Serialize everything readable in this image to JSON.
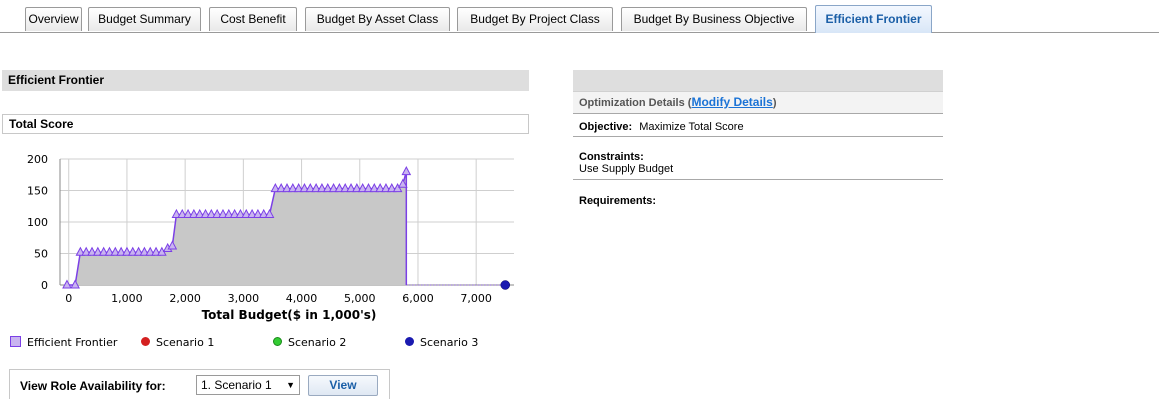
{
  "tabs": [
    {
      "label": "Overview",
      "active": false
    },
    {
      "label": "Budget Summary",
      "active": false
    },
    {
      "label": "Cost Benefit",
      "active": false
    },
    {
      "label": "Budget By Asset Class",
      "active": false
    },
    {
      "label": "Budget By Project Class",
      "active": false
    },
    {
      "label": "Budget By Business Objective",
      "active": false
    },
    {
      "label": "Efficient Frontier",
      "active": true
    }
  ],
  "left_panel": {
    "title": "Efficient Frontier",
    "chart_header": "Total Score"
  },
  "chart_data": {
    "type": "area",
    "title": "Total Score",
    "xlabel": "Total Budget($ in 1,000's)",
    "ylabel": "",
    "xlim": [
      -150,
      7650
    ],
    "ylim": [
      0,
      200
    ],
    "x_ticks": [
      "0",
      "1,000",
      "2,000",
      "3,000",
      "4,000",
      "5,000",
      "6,000",
      "7,000"
    ],
    "y_ticks": [
      "0",
      "50",
      "100",
      "150",
      "200"
    ],
    "grid": true,
    "legend_position": "bottom",
    "series": [
      {
        "name": "Efficient Frontier",
        "color": "#7b3fe6",
        "fill": "#c8c8c8",
        "marker": "triangle",
        "points": [
          [
            -30,
            0
          ],
          [
            110,
            0
          ],
          [
            200,
            52
          ],
          [
            300,
            52
          ],
          [
            400,
            52
          ],
          [
            500,
            52
          ],
          [
            600,
            52
          ],
          [
            700,
            52
          ],
          [
            800,
            52
          ],
          [
            900,
            52
          ],
          [
            1000,
            52
          ],
          [
            1100,
            52
          ],
          [
            1200,
            52
          ],
          [
            1300,
            52
          ],
          [
            1400,
            52
          ],
          [
            1500,
            52
          ],
          [
            1600,
            52
          ],
          [
            1700,
            58
          ],
          [
            1780,
            62
          ],
          [
            1850,
            112
          ],
          [
            1950,
            112
          ],
          [
            2050,
            112
          ],
          [
            2150,
            112
          ],
          [
            2250,
            112
          ],
          [
            2350,
            112
          ],
          [
            2450,
            112
          ],
          [
            2550,
            112
          ],
          [
            2650,
            112
          ],
          [
            2750,
            112
          ],
          [
            2850,
            112
          ],
          [
            2950,
            112
          ],
          [
            3050,
            112
          ],
          [
            3150,
            112
          ],
          [
            3250,
            112
          ],
          [
            3350,
            112
          ],
          [
            3450,
            112
          ],
          [
            3550,
            153
          ],
          [
            3650,
            153
          ],
          [
            3750,
            153
          ],
          [
            3850,
            153
          ],
          [
            3950,
            153
          ],
          [
            4050,
            153
          ],
          [
            4150,
            153
          ],
          [
            4250,
            153
          ],
          [
            4350,
            153
          ],
          [
            4450,
            153
          ],
          [
            4550,
            153
          ],
          [
            4650,
            153
          ],
          [
            4750,
            153
          ],
          [
            4850,
            153
          ],
          [
            4950,
            153
          ],
          [
            5050,
            153
          ],
          [
            5150,
            153
          ],
          [
            5250,
            153
          ],
          [
            5350,
            153
          ],
          [
            5450,
            153
          ],
          [
            5550,
            153
          ],
          [
            5650,
            153
          ],
          [
            5740,
            160
          ],
          [
            5800,
            180
          ]
        ]
      },
      {
        "name": "Scenario 1",
        "color": "#d42020",
        "marker": "circle",
        "points": []
      },
      {
        "name": "Scenario 2",
        "color": "#33cc33",
        "marker": "circle",
        "points": []
      },
      {
        "name": "Scenario 3",
        "color": "#1a1ab0",
        "marker": "circle",
        "points": [
          [
            7500,
            0
          ]
        ]
      }
    ]
  },
  "role_availability": {
    "label": "View Role Availability for:",
    "selected": "1. Scenario 1",
    "button": "View"
  },
  "right_panel": {
    "title": "",
    "details_prefix": "Optimization Details (",
    "details_link": "Modify Details",
    "details_suffix": ")",
    "objective_label": "Objective:",
    "objective_value": "Maximize Total Score",
    "constraints_label": "Constraints:",
    "constraints_value": "Use Supply Budget",
    "requirements_label": "Requirements:"
  }
}
